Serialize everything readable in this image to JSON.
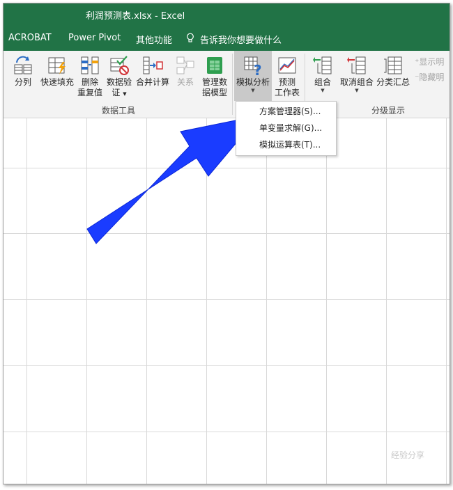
{
  "window": {
    "title": "利润预测表.xlsx  -  Excel"
  },
  "tabs": [
    "ACROBAT",
    "Power Pivot",
    "其他功能"
  ],
  "tell_me": "告诉我你想要做什么",
  "ribbon": {
    "data_tools": {
      "label": "数据工具",
      "split": "分列",
      "flash_fill": "快速填充",
      "remove_dup_1": "删除",
      "remove_dup_2": "重复值",
      "validation_1": "数据验",
      "validation_2": "证",
      "consolidate": "合并计算",
      "relationships": "关系",
      "data_model_1": "管理数",
      "data_model_2": "据模型"
    },
    "forecast": {
      "whatif": "模拟分析",
      "sheet_1": "预测",
      "sheet_2": "工作表"
    },
    "outline": {
      "label": "分级显示",
      "group": "组合",
      "ungroup": "取消组合",
      "subtotal": "分类汇总",
      "show_detail": "显示明",
      "hide_detail": "隐藏明"
    }
  },
  "whatif_menu": [
    "方案管理器(S)...",
    "单变量求解(G)...",
    "模拟运算表(T)..."
  ],
  "colors": {
    "excel_green": "#217346",
    "arrow_blue": "#1a3cff"
  },
  "watermark": "经验分享"
}
